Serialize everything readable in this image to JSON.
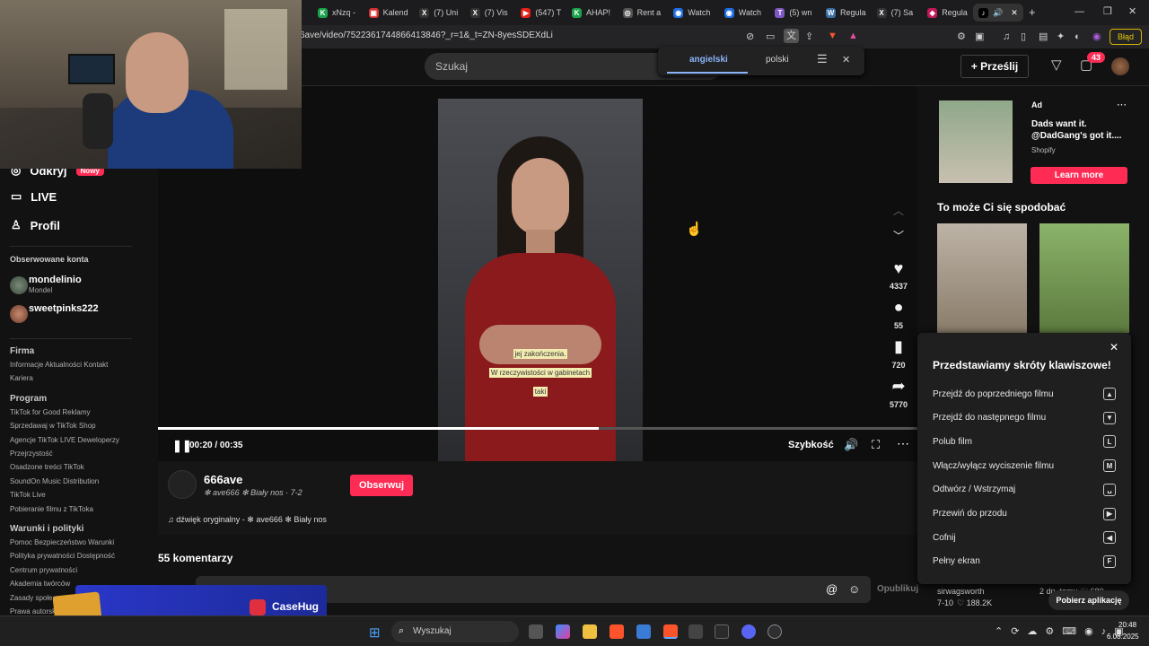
{
  "browser": {
    "tabs": [
      {
        "label": "xNzq -",
        "color": "#1aa34a",
        "glyph": "K"
      },
      {
        "label": "Kalend",
        "color": "#d63030",
        "glyph": "▣"
      },
      {
        "label": "(7) Uni",
        "color": "#333333",
        "glyph": "X"
      },
      {
        "label": "(7) Vis",
        "color": "#333333",
        "glyph": "X"
      },
      {
        "label": "(547) T",
        "color": "#e62117",
        "glyph": "▶"
      },
      {
        "label": "AHAP!",
        "color": "#1aa34a",
        "glyph": "K"
      },
      {
        "label": "Rent a",
        "color": "#555555",
        "glyph": "◎"
      },
      {
        "label": "Watch",
        "color": "#1d6fe0",
        "glyph": "◉"
      },
      {
        "label": "Watch",
        "color": "#1d6fe0",
        "glyph": "◉"
      },
      {
        "label": "(5) wn",
        "color": "#7e57c2",
        "glyph": "T"
      },
      {
        "label": "Regula",
        "color": "#3a6ea5",
        "glyph": "W"
      },
      {
        "label": "(7) Sa",
        "color": "#333333",
        "glyph": "X"
      },
      {
        "label": "Regula",
        "color": "#c2185b",
        "glyph": "◆"
      }
    ],
    "url": "6ave/video/7522361744866413846?_r=1&_t=ZN-8yesSDEXdLi",
    "error_badge": "Błąd"
  },
  "translate": {
    "lang_from": "angielski",
    "lang_to": "polski"
  },
  "header": {
    "search_placeholder": "Szukaj",
    "upload_label": "Prześlij",
    "inbox_count": "43"
  },
  "sidebar": {
    "explore_label": "Odkryj",
    "explore_badge": "Nowy",
    "live_label": "LIVE",
    "profile_label": "Profil",
    "following_heading": "Obserwowane konta",
    "accounts": [
      {
        "name": "mondelinio",
        "sub": "Mondel"
      },
      {
        "name": "sweetpinks222",
        "sub": ""
      }
    ],
    "sections": [
      {
        "heading": "Firma",
        "lines": [
          "Informacje  Aktualności  Kontakt",
          "Kariera"
        ]
      },
      {
        "heading": "Program",
        "lines": [
          "TikTok for Good  Reklamy",
          "Sprzedawaj w TikTok Shop",
          "Agencje TikTok LIVE  Deweloperzy",
          "Przejrzystość",
          "Osadzone treści TikTok",
          "SoundOn Music Distribution",
          "TikTok Live",
          "Pobieranie filmu z TikToka"
        ]
      },
      {
        "heading": "Warunki i polityki",
        "lines": [
          "Pomoc  Bezpieczeństwo  Warunki",
          "Polityka prywatności  Dostępność",
          "Centrum prywatności",
          "Akademia twórców",
          "Zasady społeczności",
          "Prawa autorskie"
        ]
      }
    ]
  },
  "video": {
    "subtitles": [
      "jej zakończenia.",
      "W rzeczywistości w gabinetach",
      "taki"
    ],
    "progress": 0.58,
    "time": "00:20 / 00:35",
    "speed_label": "Szybkość",
    "likes": "4337",
    "comments": "55",
    "saves": "720",
    "shares": "5770"
  },
  "author": {
    "handle": "666ave",
    "nickname": "✻ ave666 ✻ Biały nos · 7-2",
    "follow_label": "Obserwuj",
    "sound": "♫ dźwięk oryginalny - ✻ ave666 ✻ Biały nos"
  },
  "comments": {
    "heading": "55 komentarzy",
    "post_label": "Opublikuj"
  },
  "ad": {
    "tag": "Ad",
    "title": "Dads want it. @DadGang's got it....",
    "sponsor": "Shopify",
    "cta": "Learn more"
  },
  "recommend": {
    "heading": "To może Ci się spodobać",
    "bottom_user": "sirwagsworth",
    "bottom_date": "2 dn. temu",
    "bottom_likes": "680",
    "bottom_meta": "7-10",
    "bottom_views": "188.2K",
    "download_app": "Pobierz aplikację"
  },
  "shortcuts": {
    "title": "Przedstawiamy skróty klawiszowe!",
    "items": [
      {
        "label": "Przejdź do poprzedniego filmu",
        "key": "▲"
      },
      {
        "label": "Przejdź do następnego filmu",
        "key": "▼"
      },
      {
        "label": "Polub film",
        "key": "L"
      },
      {
        "label": "Włącz/wyłącz wyciszenie filmu",
        "key": "M"
      },
      {
        "label": "Odtwórz / Wstrzymaj",
        "key": "␣"
      },
      {
        "label": "Przewiń do przodu",
        "key": "▶"
      },
      {
        "label": "Cofnij",
        "key": "◀"
      },
      {
        "label": "Pełny ekran",
        "key": "F"
      }
    ]
  },
  "taskbar": {
    "search": "Wyszukaj",
    "time": "20:48",
    "date": "6.08.2025"
  },
  "overlay": {
    "brand": "CaseHug"
  }
}
